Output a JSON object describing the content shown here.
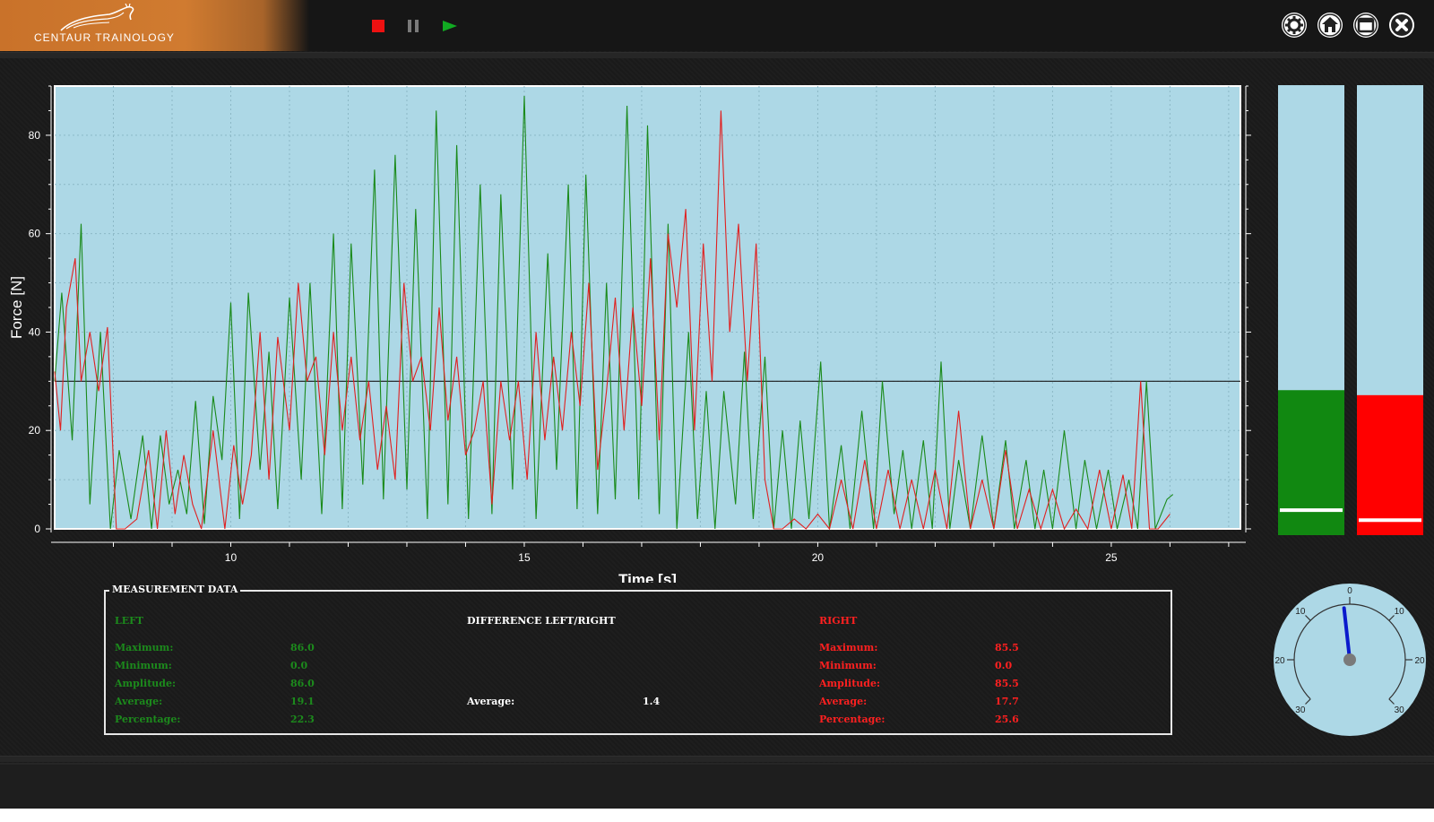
{
  "app": {
    "brand": "CENTAUR TRAINOLOGY"
  },
  "colors": {
    "left": "#1a8a1a",
    "right": "#e02020",
    "plot_bg": "#add8e6",
    "needle": "#0a1acc"
  },
  "toolbar": {
    "stop_icon": "stop-icon",
    "pause_icon": "pause-icon",
    "play_icon": "play-icon"
  },
  "window_controls": [
    "settings-icon",
    "home-icon",
    "window-icon",
    "close-icon"
  ],
  "chart_data": {
    "type": "line",
    "xlabel": "Time [s]",
    "ylabel": "Force [N]",
    "xlim": [
      7.0,
      27.2
    ],
    "ylim": [
      0,
      90
    ],
    "xticks": [
      10,
      15,
      20,
      25
    ],
    "yticks": [
      0,
      20,
      40,
      60,
      80
    ],
    "grid": true,
    "threshold": 30,
    "series": [
      {
        "color": "#1a8a1a",
        "x": [
          7.0,
          7.12,
          7.3,
          7.45,
          7.6,
          7.78,
          7.95,
          8.1,
          8.3,
          8.5,
          8.65,
          8.8,
          8.95,
          9.1,
          9.25,
          9.4,
          9.55,
          9.7,
          9.85,
          10.0,
          10.15,
          10.3,
          10.5,
          10.65,
          10.8,
          11.0,
          11.2,
          11.35,
          11.55,
          11.75,
          11.9,
          12.05,
          12.25,
          12.45,
          12.6,
          12.8,
          13.0,
          13.15,
          13.35,
          13.5,
          13.7,
          13.85,
          14.05,
          14.25,
          14.45,
          14.6,
          14.8,
          15.0,
          15.2,
          15.4,
          15.55,
          15.75,
          15.9,
          16.05,
          16.25,
          16.4,
          16.55,
          16.75,
          16.95,
          17.1,
          17.3,
          17.45,
          17.6,
          17.8,
          17.95,
          18.1,
          18.25,
          18.4,
          18.6,
          18.75,
          18.9,
          19.1,
          19.25,
          19.4,
          19.55,
          19.7,
          19.85,
          20.05,
          20.2,
          20.4,
          20.55,
          20.75,
          20.95,
          21.1,
          21.3,
          21.45,
          21.6,
          21.8,
          21.95,
          22.1,
          22.25,
          22.4,
          22.6,
          22.8,
          23.0,
          23.2,
          23.35,
          23.55,
          23.7,
          23.85,
          24.0,
          24.2,
          24.4,
          24.55,
          24.75,
          24.95,
          25.1,
          25.3,
          25.45,
          25.6,
          25.75,
          25.95,
          26.05
        ],
        "values": [
          30,
          48,
          18,
          62,
          5,
          40,
          0,
          16,
          2,
          19,
          0,
          19,
          5,
          12,
          3,
          26,
          1,
          27,
          14,
          46,
          2,
          48,
          12,
          36,
          4,
          47,
          10,
          50,
          3,
          60,
          4,
          58,
          9,
          73,
          6,
          76,
          8,
          65,
          2,
          85,
          5,
          78,
          2,
          70,
          3,
          68,
          8,
          88,
          2,
          56,
          12,
          70,
          4,
          72,
          3,
          50,
          6,
          86,
          6,
          82,
          3,
          62,
          0,
          40,
          2,
          28,
          0,
          28,
          5,
          36,
          2,
          35,
          0,
          20,
          0,
          22,
          2,
          34,
          0,
          17,
          0,
          24,
          0,
          30,
          3,
          16,
          0,
          18,
          0,
          34,
          0,
          14,
          0,
          19,
          0,
          18,
          0,
          14,
          0,
          12,
          0,
          20,
          0,
          14,
          0,
          12,
          0,
          10,
          0,
          30,
          0,
          6,
          7
        ]
      },
      {
        "color": "#e02020",
        "x": [
          7.0,
          7.1,
          7.2,
          7.35,
          7.45,
          7.6,
          7.75,
          7.9,
          8.05,
          8.2,
          8.4,
          8.6,
          8.75,
          8.9,
          9.05,
          9.2,
          9.35,
          9.5,
          9.7,
          9.9,
          10.05,
          10.2,
          10.35,
          10.5,
          10.65,
          10.8,
          11.0,
          11.15,
          11.3,
          11.45,
          11.6,
          11.75,
          11.9,
          12.05,
          12.2,
          12.35,
          12.5,
          12.65,
          12.8,
          12.95,
          13.1,
          13.25,
          13.4,
          13.55,
          13.7,
          13.85,
          14.0,
          14.15,
          14.3,
          14.45,
          14.6,
          14.75,
          14.9,
          15.05,
          15.2,
          15.35,
          15.5,
          15.65,
          15.8,
          15.95,
          16.1,
          16.25,
          16.4,
          16.55,
          16.7,
          16.85,
          17.0,
          17.15,
          17.3,
          17.45,
          17.6,
          17.75,
          17.9,
          18.05,
          18.2,
          18.35,
          18.5,
          18.65,
          18.8,
          18.95,
          19.1,
          19.25,
          19.4,
          19.6,
          19.8,
          20.0,
          20.2,
          20.4,
          20.6,
          20.8,
          21.0,
          21.2,
          21.4,
          21.6,
          21.8,
          22.0,
          22.2,
          22.4,
          22.6,
          22.8,
          23.0,
          23.2,
          23.4,
          23.6,
          23.8,
          24.0,
          24.2,
          24.4,
          24.6,
          24.8,
          25.0,
          25.2,
          25.35,
          25.5,
          25.65,
          25.8,
          26.0
        ],
        "values": [
          32,
          20,
          45,
          55,
          30,
          40,
          28,
          41,
          0,
          0,
          2,
          16,
          0,
          20,
          3,
          15,
          5,
          0,
          20,
          0,
          17,
          5,
          15,
          40,
          10,
          39,
          20,
          50,
          30,
          35,
          15,
          40,
          20,
          35,
          18,
          30,
          12,
          25,
          10,
          50,
          30,
          35,
          20,
          45,
          22,
          35,
          15,
          20,
          30,
          5,
          30,
          18,
          30,
          10,
          40,
          18,
          35,
          20,
          40,
          25,
          50,
          12,
          28,
          47,
          20,
          45,
          25,
          55,
          18,
          60,
          45,
          65,
          20,
          58,
          30,
          85,
          40,
          62,
          30,
          58,
          10,
          0,
          0,
          2,
          0,
          3,
          0,
          10,
          0,
          14,
          0,
          12,
          0,
          10,
          0,
          12,
          0,
          24,
          0,
          10,
          0,
          16,
          0,
          8,
          0,
          8,
          0,
          4,
          0,
          12,
          0,
          11,
          0,
          30,
          0,
          0,
          3
        ]
      }
    ]
  },
  "bars": [
    {
      "side": "left",
      "color": "#118811",
      "value": 29,
      "marker": 5
    },
    {
      "side": "right",
      "color": "#ff0000",
      "value": 28,
      "marker": 3
    }
  ],
  "bars_axis": {
    "max": 90,
    "ticks": [
      0,
      20,
      40,
      60,
      80
    ]
  },
  "gauge": {
    "top_label": "0",
    "left_labels": [
      "10",
      "20",
      "30"
    ],
    "right_labels": [
      "10",
      "20",
      "30"
    ],
    "needle_value": -1.4
  },
  "measurement": {
    "title": "MEASUREMENT DATA",
    "left": {
      "header": "LEFT",
      "rows": [
        {
          "label": "Maximum:",
          "value": "86.0"
        },
        {
          "label": "Minimum:",
          "value": "0.0"
        },
        {
          "label": "Amplitude:",
          "value": "86.0"
        },
        {
          "label": "Average:",
          "value": "19.1"
        },
        {
          "label": "Percentage:",
          "value": "22.3"
        }
      ]
    },
    "diff": {
      "header": "DIFFERENCE LEFT/RIGHT",
      "label": "Average:",
      "value": "1.4"
    },
    "right": {
      "header": "RIGHT",
      "rows": [
        {
          "label": "Maximum:",
          "value": "85.5"
        },
        {
          "label": "Minimum:",
          "value": "0.0"
        },
        {
          "label": "Amplitude:",
          "value": "85.5"
        },
        {
          "label": "Average:",
          "value": "17.7"
        },
        {
          "label": "Percentage:",
          "value": "25.6"
        }
      ]
    }
  }
}
